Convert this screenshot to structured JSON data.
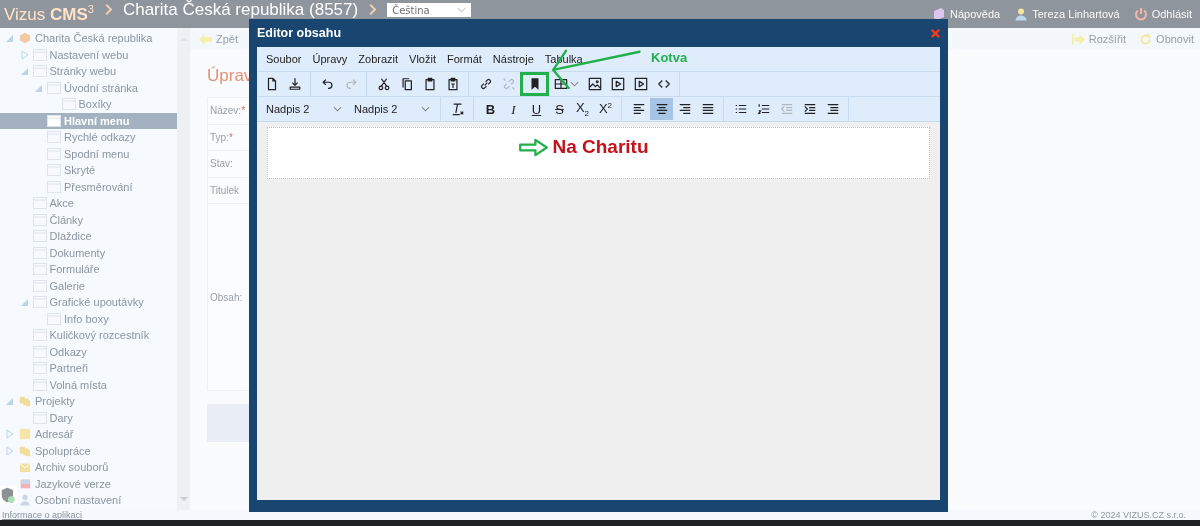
{
  "header": {
    "logo": "Vizus **CMS**$^{3}$",
    "site": "Charita Česká republika (8557)",
    "language": {
      "value": "Čeština"
    },
    "links": [
      {
        "kind": "help",
        "label": "Nápověda"
      },
      {
        "kind": "user",
        "label": "Tereza Linhartová"
      },
      {
        "kind": "logout",
        "label": "Odhlásit"
      }
    ]
  },
  "sidebar": {
    "tree": [
      {
        "label": "Charita Česká republika",
        "kind": "cube",
        "expanded": true,
        "selected": false,
        "children": [
          {
            "label": "Nastavení webu",
            "kind": "page",
            "expanded": false,
            "selected": false
          },
          {
            "label": "Stránky webu",
            "kind": "page",
            "expanded": true,
            "selected": false,
            "children": [
              {
                "label": "Úvodní stránka",
                "kind": "page",
                "expanded": true,
                "selected": false,
                "children": [
                  {
                    "label": "Boxíky",
                    "kind": "page",
                    "selected": false
                  }
                ]
              },
              {
                "label": "Hlavní menu",
                "kind": "page",
                "selected": true
              },
              {
                "label": "Rychlé odkazy",
                "kind": "page",
                "selected": false
              },
              {
                "label": "Spodní menu",
                "kind": "page",
                "selected": false
              },
              {
                "label": "Skryté",
                "kind": "page",
                "selected": false
              },
              {
                "label": "Přesměrování",
                "kind": "page",
                "selected": false
              }
            ]
          },
          {
            "label": "Akce",
            "kind": "page",
            "selected": false
          },
          {
            "label": "Články",
            "kind": "page",
            "selected": false
          },
          {
            "label": "Dlaždice",
            "kind": "page",
            "selected": false
          },
          {
            "label": "Dokumenty",
            "kind": "page",
            "selected": false
          },
          {
            "label": "Formuláře",
            "kind": "page",
            "selected": false
          },
          {
            "label": "Galerie",
            "kind": "page",
            "selected": false
          },
          {
            "label": "Grafické upoutávky",
            "kind": "page",
            "expanded": true,
            "selected": false,
            "children": [
              {
                "label": "Info boxy",
                "kind": "page",
                "selected": false
              }
            ]
          },
          {
            "label": "Kuličkový rozcestník",
            "kind": "page",
            "selected": false
          },
          {
            "label": "Odkazy",
            "kind": "page",
            "selected": false
          },
          {
            "label": "Partneři",
            "kind": "page",
            "selected": false
          },
          {
            "label": "Volná místa",
            "kind": "page",
            "selected": false
          }
        ]
      },
      {
        "label": "Projekty",
        "kind": "folders",
        "expanded": true,
        "selected": false,
        "children": [
          {
            "label": "Dary",
            "kind": "page",
            "selected": false
          }
        ]
      },
      {
        "label": "Adresář",
        "kind": "folder",
        "expanded": false,
        "selected": false
      },
      {
        "label": "Spolupráce",
        "kind": "folders",
        "expanded": false,
        "selected": false
      },
      {
        "label": "Archiv souborů",
        "kind": "archive",
        "selected": false
      },
      {
        "label": "Jazykové verze",
        "kind": "language",
        "selected": false
      },
      {
        "label": "Osobní nastavení",
        "kind": "settings",
        "selected": false
      }
    ]
  },
  "toolbar": {
    "left": [
      {
        "kind": "back",
        "label": "Zpět"
      }
    ],
    "right": [
      {
        "kind": "expand",
        "label": "Rozšířit"
      },
      {
        "kind": "refresh",
        "label": "Obnovit"
      }
    ]
  },
  "page": {
    "title": "Úprav",
    "fields": [
      {
        "label": "Název:",
        "required_mark": "*"
      },
      {
        "label": "Typ:",
        "required_mark": "*"
      },
      {
        "label": "Stav:"
      },
      {
        "label": "Titulek"
      },
      {
        "label": "Obsah:"
      }
    ]
  },
  "modal": {
    "title": "Editor obsahu",
    "menu": [
      "Soubor",
      "Úpravy",
      "Zobrazit",
      "Vložit",
      "Formát",
      "Nástroje",
      "Tabulka"
    ],
    "toolbar_row_1": [
      [
        {
          "kind": "new-doc",
          "disabled": false,
          "selected": false
        },
        {
          "kind": "download",
          "disabled": false,
          "selected": false
        }
      ],
      [
        {
          "kind": "undo",
          "disabled": false,
          "selected": false
        },
        {
          "kind": "redo",
          "disabled": true,
          "selected": false
        }
      ],
      [
        {
          "kind": "cut",
          "disabled": false,
          "selected": false
        },
        {
          "kind": "copy",
          "disabled": false,
          "selected": false
        },
        {
          "kind": "paste",
          "disabled": false,
          "selected": false
        },
        {
          "kind": "paste-text",
          "disabled": false,
          "selected": false
        }
      ],
      [
        {
          "kind": "link",
          "disabled": false,
          "selected": false
        },
        {
          "kind": "unlink",
          "disabled": true,
          "selected": false
        },
        {
          "kind": "bookmark",
          "disabled": false,
          "selected": false,
          "annotated": true
        },
        {
          "kind": "table",
          "disabled": false,
          "selected": false,
          "caret": true
        },
        {
          "kind": "image",
          "disabled": false,
          "selected": false
        },
        {
          "kind": "media",
          "disabled": false,
          "selected": false
        },
        {
          "kind": "media",
          "disabled": false,
          "selected": false
        },
        {
          "kind": "code",
          "disabled": false,
          "selected": false
        }
      ]
    ],
    "selects": [
      {
        "value": "Nadpis 2"
      },
      {
        "value": "Nadpis 2"
      }
    ],
    "toolbar_row_2": [
      [
        {
          "kind": "clear-format",
          "disabled": false,
          "selected": false
        }
      ],
      [
        {
          "kind": "bold",
          "label": "B",
          "disabled": false,
          "selected": false
        },
        {
          "kind": "italic",
          "label": "I",
          "disabled": false,
          "selected": false
        },
        {
          "kind": "underline",
          "label": "U",
          "disabled": false,
          "selected": false
        },
        {
          "kind": "strike",
          "label": "S",
          "disabled": false,
          "selected": false
        },
        {
          "kind": "script",
          "label": "X$_{2}$",
          "disabled": false,
          "selected": false
        },
        {
          "kind": "script",
          "label": "X$^{2}$",
          "disabled": false,
          "selected": false
        }
      ],
      [
        {
          "kind": "align-left",
          "disabled": false,
          "selected": false
        },
        {
          "kind": "align-center",
          "disabled": false,
          "selected": true
        },
        {
          "kind": "align-right",
          "disabled": false,
          "selected": false
        },
        {
          "kind": "justify",
          "disabled": false,
          "selected": false
        }
      ],
      [
        {
          "kind": "bullet-list",
          "disabled": false,
          "selected": false
        },
        {
          "kind": "numbered-list",
          "disabled": false,
          "selected": false
        },
        {
          "kind": "outdent",
          "disabled": true,
          "selected": false
        },
        {
          "kind": "indent",
          "disabled": false,
          "selected": false
        },
        {
          "kind": "list-lines",
          "disabled": false,
          "selected": false
        }
      ]
    ],
    "content": {
      "heading": "Na Charitu",
      "arrow_marker": true
    },
    "annotation": {
      "label": "Kotva"
    }
  },
  "footer": {
    "link": "Informace o aplikaci",
    "copyright": "© 2024 VIZUS.CZ s.r.o."
  }
}
